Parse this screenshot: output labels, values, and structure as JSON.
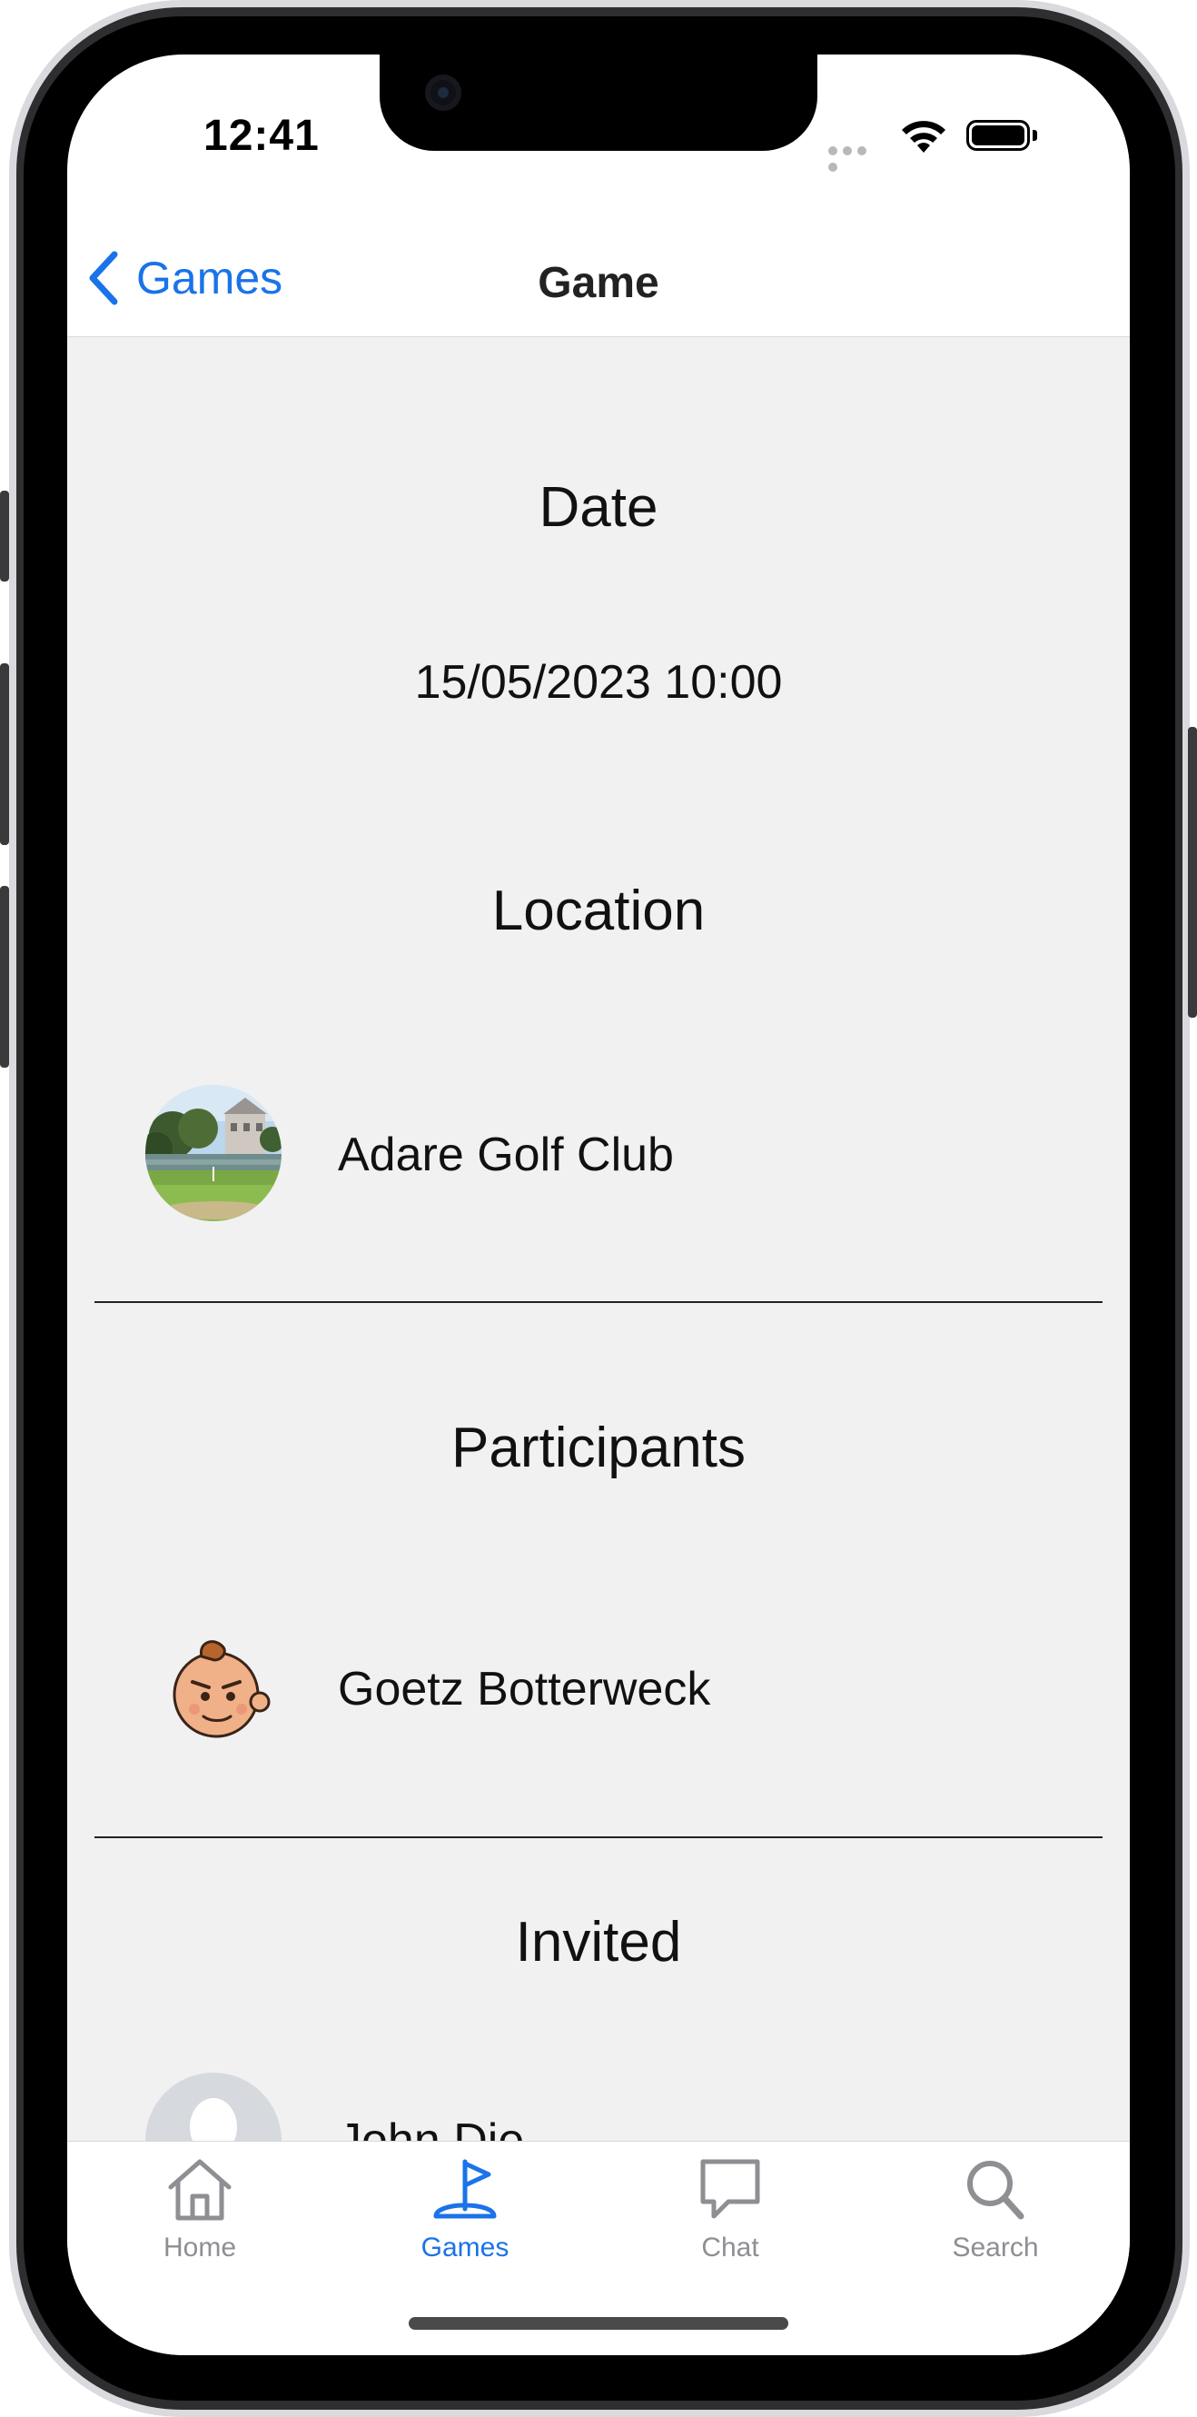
{
  "status_bar": {
    "time": "12:41"
  },
  "nav": {
    "back_label": "Games",
    "title": "Game"
  },
  "date_section": {
    "title": "Date",
    "value": "15/05/2023 10:00"
  },
  "location_section": {
    "title": "Location",
    "name": "Adare Golf Club"
  },
  "participants_section": {
    "title": "Participants",
    "people": [
      "Goetz Botterweck"
    ]
  },
  "invited_section": {
    "title": "Invited",
    "people": [
      "John Die"
    ]
  },
  "tabs": [
    {
      "label": "Home",
      "icon": "house-icon",
      "active": false
    },
    {
      "label": "Games",
      "icon": "golf-flag-icon",
      "active": true
    },
    {
      "label": "Chat",
      "icon": "chat-bubble-icon",
      "active": false
    },
    {
      "label": "Search",
      "icon": "magnifier-icon",
      "active": false
    }
  ],
  "colors": {
    "accent": "#1a73e8",
    "content_bg": "#f1f1f1",
    "tab_inactive": "#8e8e93"
  }
}
